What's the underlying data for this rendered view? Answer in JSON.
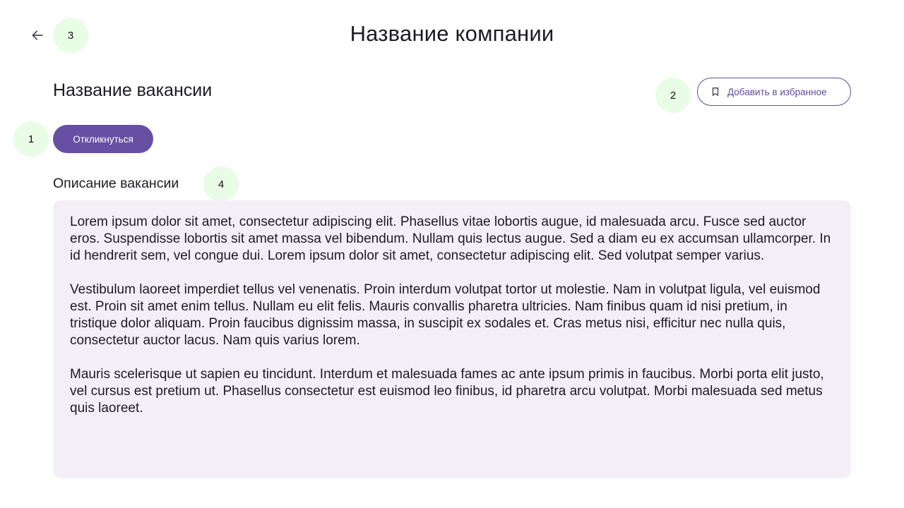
{
  "header": {
    "title": "Название компании",
    "back_icon": "arrow-left-icon"
  },
  "markers": [
    "1",
    "2",
    "3",
    "4"
  ],
  "vacancy": {
    "title": "Название вакансии",
    "favorite_label": "Добавить в избранное",
    "favorite_icon": "bookmark-icon",
    "apply_label": "Откликнуться"
  },
  "description": {
    "heading": "Описание вакансии",
    "paragraphs": [
      "Lorem ipsum dolor sit amet, consectetur adipiscing elit. Phasellus vitae lobortis augue, id malesuada arcu. Fusce sed auctor eros. Suspendisse lobortis sit amet massa vel bibendum. Nullam quis lectus augue. Sed a diam eu ex accumsan ullamcorper. In id hendrerit sem, vel congue dui. Lorem ipsum dolor sit amet, consectetur adipiscing elit. Sed volutpat semper varius.",
      "Vestibulum laoreet imperdiet tellus vel venenatis. Proin interdum volutpat tortor ut molestie. Nam in volutpat ligula, vel euismod est. Proin sit amet enim tellus. Nullam eu elit felis. Mauris convallis pharetra ultricies. Nam finibus quam id nisi pretium, in tristique dolor aliquam. Proin faucibus dignissim massa, in suscipit ex sodales et. Cras metus nisi, efficitur nec nulla quis, consectetur auctor lacus. Nam quis varius lorem.",
      "Mauris scelerisque ut sapien eu tincidunt. Interdum et malesuada fames ac ante ipsum primis in faucibus. Morbi porta elit justo, vel cursus est pretium ut. Phasellus consectetur est euismod leo finibus, id pharetra arcu volutpat. Morbi malesuada sed metus quis laoreet."
    ]
  },
  "colors": {
    "primary": "#6750a4",
    "description_bg": "#f4eff7",
    "marker_bg": "#e9fce6"
  }
}
